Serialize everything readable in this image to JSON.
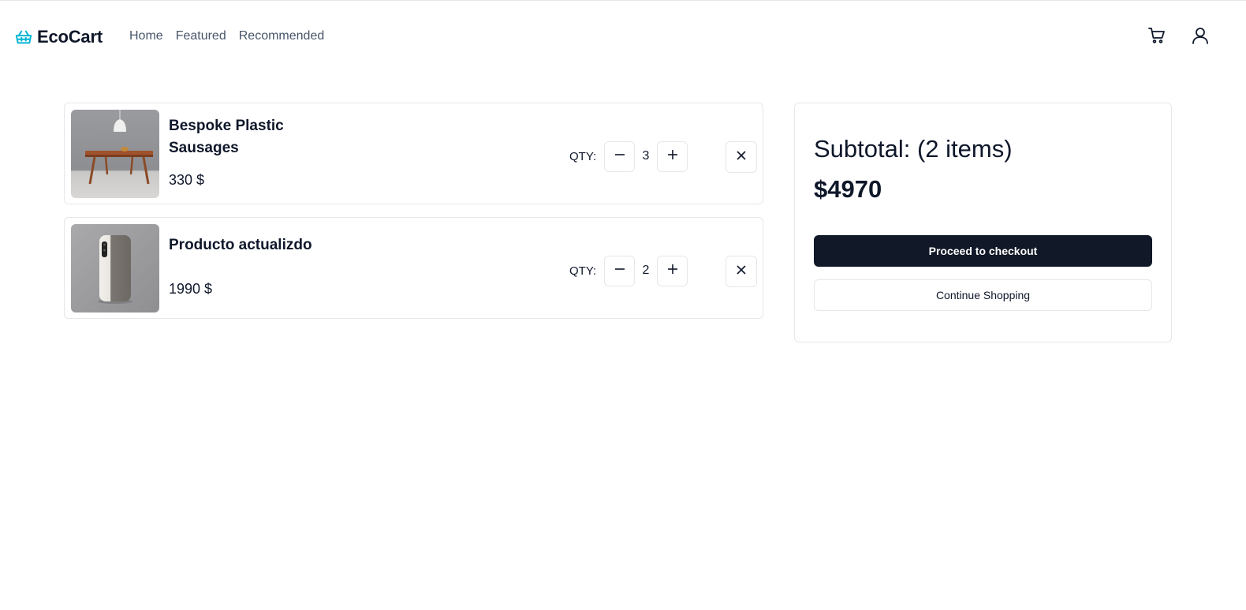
{
  "header": {
    "brand": "EcoCart",
    "nav": [
      {
        "label": "Home"
      },
      {
        "label": "Featured"
      },
      {
        "label": "Recommended"
      }
    ],
    "icons": [
      "basket-icon",
      "cart-icon",
      "user-icon"
    ]
  },
  "cart": {
    "qty_label": "QTY:",
    "items": [
      {
        "name": "Bespoke Plastic Sausages",
        "price": "330 $",
        "quantity": "3",
        "image": "wooden-table-with-pendant-lamp"
      },
      {
        "name": "Producto actualizdo",
        "price": "1990 $",
        "quantity": "2",
        "image": "gray-white-phone-case"
      }
    ]
  },
  "summary": {
    "subtotal_label": "Subtotal: (2 items)",
    "total": "$4970",
    "checkout_label": "Proceed to checkout",
    "continue_label": "Continue Shopping"
  },
  "colors": {
    "brand_accent": "#06b6d4",
    "primary_button": "#111827",
    "border": "#e5e7eb",
    "nav_text": "#475569"
  }
}
